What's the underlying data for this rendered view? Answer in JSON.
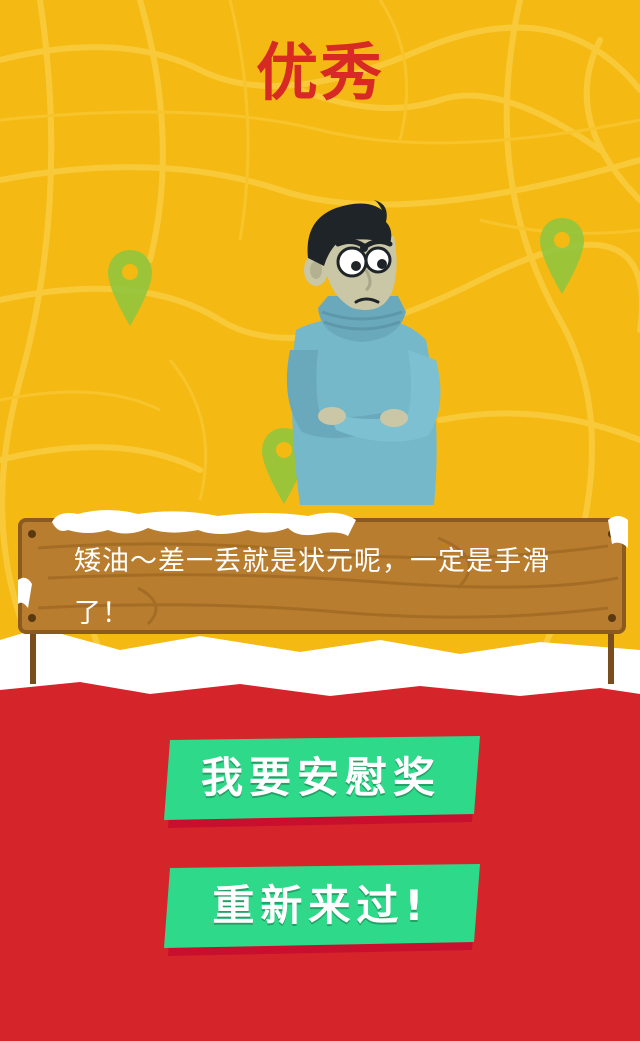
{
  "title": "优秀",
  "sign": {
    "message": "矮油～差一丢就是状元呢，一定是手滑了！"
  },
  "buttons": {
    "consolation_label": "我要安慰奖",
    "retry_label": "重新来过!"
  },
  "colors": {
    "background_yellow": "#f5b914",
    "title_red": "#d82a25",
    "bottom_red": "#d5242a",
    "button_green": "#2fd98a",
    "button_shadow": "#c8102e",
    "sign_wood": "#b87d2e",
    "sign_text": "#ffffff",
    "pin_green": "#8cc63f",
    "sweater_blue": "#74b8c9"
  },
  "icons": [
    "map-pin-icon",
    "character-figure"
  ]
}
